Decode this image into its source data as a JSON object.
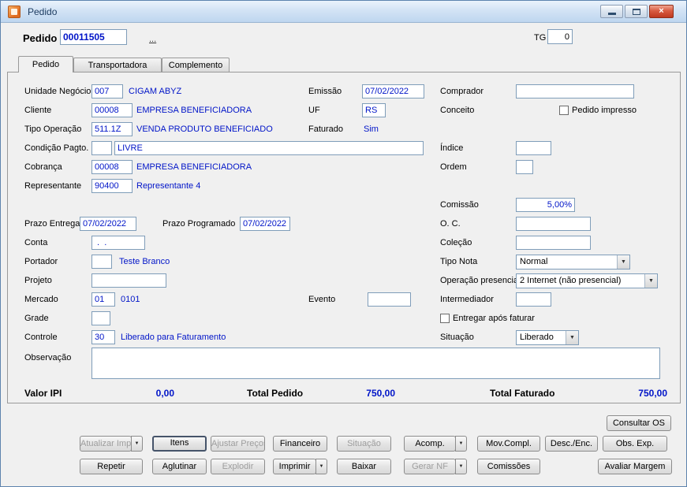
{
  "window": {
    "title": "Pedido",
    "close_glyph": "×"
  },
  "icons": {
    "dropdown": "▼"
  },
  "header": {
    "pedido_label": "Pedido",
    "pedido_value": "00011505",
    "lookup_button": "...",
    "tg_label": "TG",
    "tg_value": "0"
  },
  "tabs": [
    {
      "label": "Pedido"
    },
    {
      "label": "Transportadora"
    },
    {
      "label": "Complemento"
    }
  ],
  "fields": {
    "unidade_negocio": {
      "label": "Unidade Negócio",
      "code": "007",
      "desc": "CIGAM ABYZ"
    },
    "cliente": {
      "label": "Cliente",
      "code": "00008",
      "desc": "EMPRESA BENEFICIADORA"
    },
    "tipo_operacao": {
      "label": "Tipo Operação",
      "code": "511.1Z",
      "desc": "VENDA PRODUTO BENEFICIADO"
    },
    "condicao_pagto": {
      "label": "Condição Pagto.",
      "code": "",
      "value": "LIVRE"
    },
    "cobranca": {
      "label": "Cobrança",
      "code": "00008",
      "desc": "EMPRESA BENEFICIADORA"
    },
    "representante": {
      "label": "Representante",
      "code": "90400",
      "desc": "Representante 4"
    },
    "prazo_entrega": {
      "label": "Prazo Entrega",
      "value": "07/02/2022"
    },
    "prazo_programado": {
      "label": "Prazo Programado",
      "value": "07/02/2022"
    },
    "conta": {
      "label": "Conta",
      "value": " .  ."
    },
    "portador": {
      "label": "Portador",
      "code": "",
      "desc": "Teste Branco"
    },
    "projeto": {
      "label": "Projeto",
      "value": ""
    },
    "mercado": {
      "label": "Mercado",
      "code": "01",
      "desc": "0101"
    },
    "evento": {
      "label": "Evento",
      "value": ""
    },
    "grade": {
      "label": "Grade",
      "value": ""
    },
    "controle": {
      "label": "Controle",
      "code": "30",
      "desc": "Liberado para Faturamento"
    },
    "observacao": {
      "label": "Observação",
      "value": ""
    },
    "emissao": {
      "label": "Emissão",
      "value": "07/02/2022"
    },
    "uf": {
      "label": "UF",
      "value": "RS"
    },
    "faturado": {
      "label": "Faturado",
      "value": "Sim"
    },
    "comprador": {
      "label": "Comprador",
      "value": ""
    },
    "conceito": {
      "label": "Conceito"
    },
    "pedido_impresso": {
      "label": "Pedido impresso",
      "checked": false
    },
    "indice": {
      "label": "Índice",
      "value": ""
    },
    "ordem": {
      "label": "Ordem",
      "value": ""
    },
    "comissao": {
      "label": "Comissão",
      "value": "5,00%"
    },
    "oc": {
      "label": "O. C.",
      "value": ""
    },
    "colecao": {
      "label": "Coleção",
      "value": ""
    },
    "tipo_nota": {
      "label": "Tipo Nota",
      "value": "Normal"
    },
    "operacao_presencial": {
      "label": "Operação presencial",
      "value": "2 Internet (não presencial)"
    },
    "intermediador": {
      "label": "Intermediador",
      "value": ""
    },
    "entregar_apos_faturar": {
      "label": "Entregar após faturar",
      "checked": false
    },
    "situacao": {
      "label": "Situação",
      "value": "Liberado"
    }
  },
  "totals": {
    "valor_ipi_label": "Valor IPI",
    "valor_ipi": "0,00",
    "total_pedido_label": "Total Pedido",
    "total_pedido": "750,00",
    "total_faturado_label": "Total Faturado",
    "total_faturado": "750,00"
  },
  "buttons": {
    "consultar_os": "Consultar OS",
    "row1": [
      {
        "label": "Atualizar Imp",
        "disabled": true
      },
      {
        "label": "Itens",
        "disabled": false
      },
      {
        "label": "Ajustar Preços",
        "disabled": true
      },
      {
        "label": "Financeiro",
        "disabled": false
      },
      {
        "label": "Situação",
        "disabled": true
      },
      {
        "label": "Acomp.",
        "disabled": false
      },
      {
        "label": "Mov.Compl.",
        "disabled": false
      },
      {
        "label": "Desc./Enc.",
        "disabled": false
      },
      {
        "label": "Obs. Exp.",
        "disabled": false
      }
    ],
    "row2": [
      {
        "label": "Repetir",
        "disabled": false
      },
      {
        "label": "Aglutinar",
        "disabled": false
      },
      {
        "label": "Explodir",
        "disabled": true
      },
      {
        "label": "Imprimir",
        "disabled": false
      },
      {
        "label": "Baixar",
        "disabled": false
      },
      {
        "label": "Gerar NF",
        "disabled": true
      },
      {
        "label": "Comissões",
        "disabled": false
      },
      {
        "label": "Avaliar Margem",
        "disabled": false
      }
    ]
  }
}
